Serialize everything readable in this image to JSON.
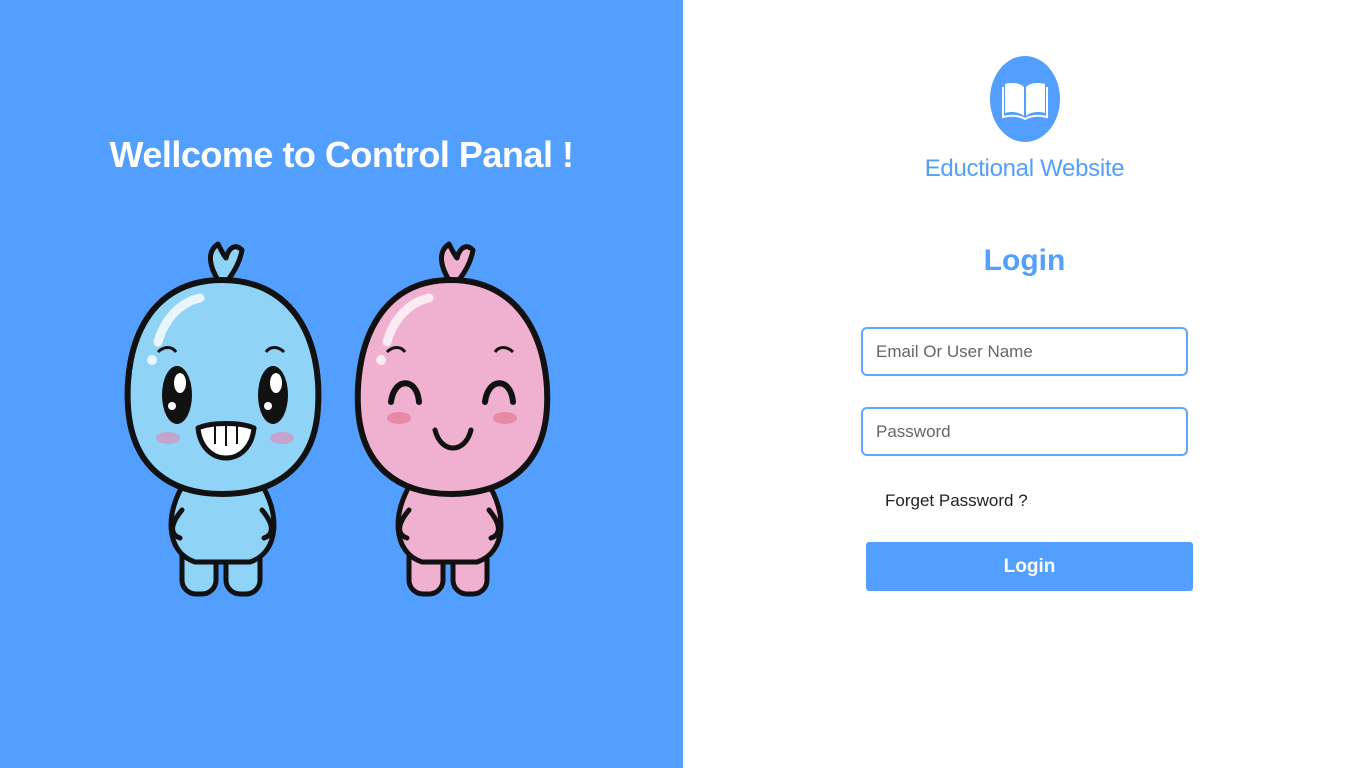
{
  "left": {
    "welcome_title": "Wellcome to Control Panal !"
  },
  "right": {
    "logo_icon": "open-book-icon",
    "brand_name": "Eductional Website",
    "login_heading": "Login",
    "email_placeholder": "Email Or User Name",
    "email_value": "",
    "password_placeholder": "Password",
    "password_value": "",
    "forgot_password": "Forget Password ?",
    "login_button": "Login"
  },
  "colors": {
    "accent": "#539fff",
    "text_on_accent": "#ffffff",
    "mascot_blue": "#8fd3f7",
    "mascot_pink": "#f0b0cf"
  }
}
